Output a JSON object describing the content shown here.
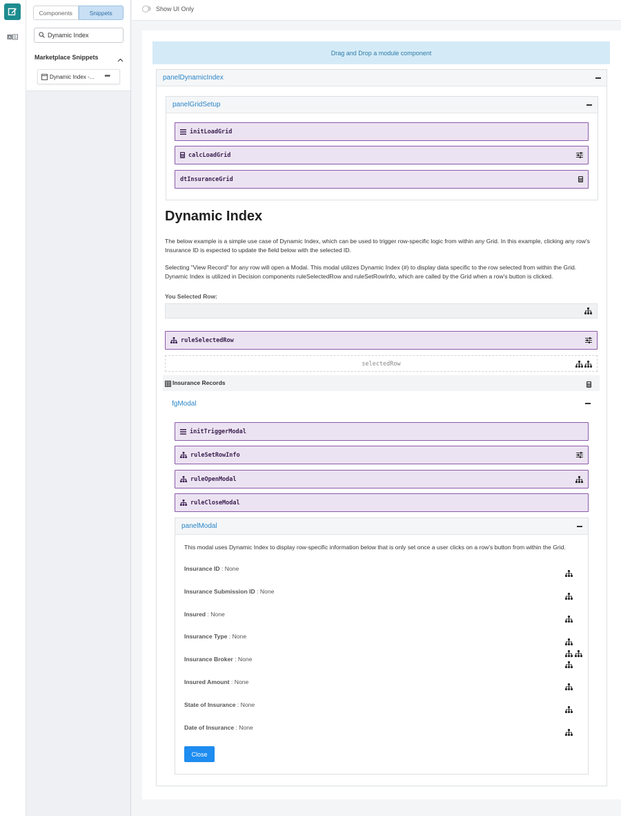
{
  "sidebar": {
    "tabs": [
      "Components",
      "Snippets"
    ],
    "active_tab": "Snippets",
    "search": {
      "value": "Dynamic Index",
      "placeholder": "Search"
    },
    "section_title": "Marketplace Snippets",
    "snippet_label": "Dynamic Index -..."
  },
  "topbar": {
    "toggle_label": "Show UI Only"
  },
  "canvas": {
    "dropzone": "Drag and Drop a module component",
    "panel_dynamic_index": "panelDynamicIndex",
    "panel_grid_setup": "panelGridSetup",
    "grid_setup_components": [
      "initLoadGrid",
      "calcLoadGrid",
      "dtInsuranceGrid"
    ],
    "heading": "Dynamic Index",
    "para1": "The below example is a simple use case of Dynamic Index, which can be used to trigger row-specific logic from within any Grid. In this example, clicking any row's Insurance ID is expected to update the field below with the selected ID.",
    "para2": "Selecting \"View Record\" for any row will open a Modal. This modal utilizes Dynamic Index (#) to display data specific to the row selected from within the Grid. Dynamic Index is utilized in Decision components ruleSelectedRow and ruleSetRowInfo, which are called by the Grid when a row's button is clicked.",
    "selected_row_label": "You Selected Row:",
    "rule_selected_row": "ruleSelectedRow",
    "selected_row_placeholder": "selectedRow",
    "insurance_records": "Insurance Records",
    "fg_modal": "fgModal",
    "fg_components": [
      "initTriggerModal",
      "ruleSetRowInfo",
      "ruleOpenModal",
      "ruleCloseModal"
    ],
    "panel_modal": "panelModal",
    "modal_description": "This modal uses Dynamic Index to display row-specific information below that is only set once a user clicks on a row's button from within the Grid.",
    "fields": [
      {
        "label": "Insurance ID",
        "value": ": None"
      },
      {
        "label": "Insurance Submission ID",
        "value": ": None"
      },
      {
        "label": "Insured",
        "value": ": None"
      },
      {
        "label": "Insurance Type",
        "value": ": None"
      },
      {
        "label": "Insurance Broker",
        "value": ": None"
      },
      {
        "label": "Insured Amount",
        "value": ": None"
      },
      {
        "label": "State of Insurance",
        "value": ": None"
      },
      {
        "label": "Date of Insurance",
        "value": ": None"
      }
    ],
    "close_label": "Close"
  },
  "colors": {
    "accent": "#1d8c8f",
    "link": "#2a86c9",
    "component_bg": "#ece3f2",
    "component_border": "#8a5aa8",
    "button": "#1e8cf0"
  }
}
